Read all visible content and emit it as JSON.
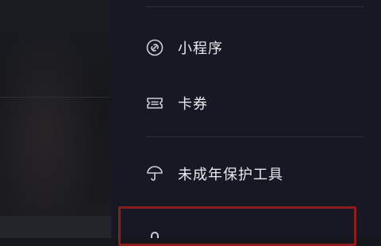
{
  "menu": {
    "items": [
      {
        "id": "mini_program",
        "label": "小程序",
        "icon": "link-chain-icon"
      },
      {
        "id": "coupons",
        "label": "卡券",
        "icon": "ticket-icon"
      },
      {
        "id": "minor_protection",
        "label": "未成年保护工具",
        "icon": "umbrella-icon"
      }
    ]
  },
  "colors": {
    "drawer_bg": "#161823",
    "text": "#e9e9ec",
    "icon": "#cfd0d4",
    "highlight_border": "#8d1c1f"
  }
}
